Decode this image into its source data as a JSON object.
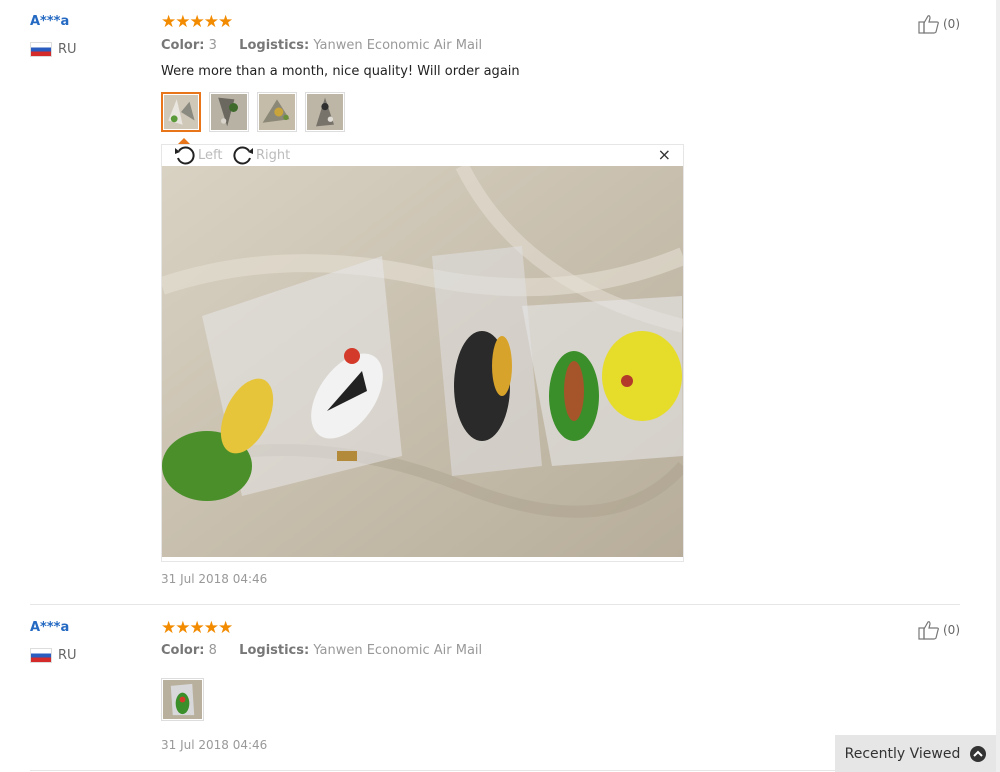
{
  "reviews": [
    {
      "user": "A***a",
      "country": "RU",
      "rating_stars": "★★★★★",
      "rating": 5,
      "color_label": "Color:",
      "color_value": "3",
      "logistics_label": "Logistics:",
      "logistics_value": "Yanwen Economic Air Mail",
      "comment": "Were more than a month, nice quality! Will order again",
      "photo_count": 4,
      "date": "31 Jul 2018 04:46",
      "likes": "(0)"
    },
    {
      "user": "A***a",
      "country": "RU",
      "rating_stars": "★★★★★",
      "rating": 5,
      "color_label": "Color:",
      "color_value": "8",
      "logistics_label": "Logistics:",
      "logistics_value": "Yanwen Economic Air Mail",
      "comment": "",
      "photo_count": 1,
      "date": "31 Jul 2018 04:46",
      "likes": "(0)"
    }
  ],
  "viewer": {
    "rotate_left": "Left",
    "rotate_right": "Right",
    "close": "×"
  },
  "recently_viewed": "Recently Viewed",
  "icons": {
    "like": "thumbs-up-icon",
    "rotate_left": "rotate-left-icon",
    "rotate_right": "rotate-right-icon",
    "close": "close-icon",
    "flag": "russia-flag-icon",
    "expand": "chevron-up-icon"
  },
  "colors": {
    "username": "#2469c2",
    "stars": "#f28b00",
    "selected_thumb": "#e8751a"
  }
}
